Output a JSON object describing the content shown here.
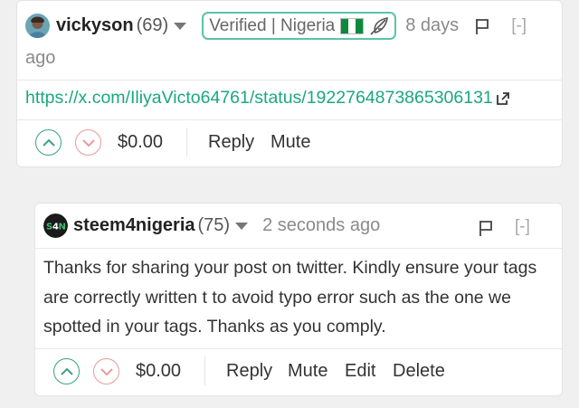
{
  "comment1": {
    "author": "vickyson",
    "reputation": "(69)",
    "badge_text": "Verified | Nigeria",
    "time_part1": "8 days",
    "time_part2": "ago",
    "collapse": "[-]",
    "link": "https://x.com/IliyaVicto64761/status/1922764873865306131",
    "payout": "$0.00",
    "actions": [
      "Reply",
      "Mute"
    ]
  },
  "comment2": {
    "author": "steem4nigeria",
    "reputation": "(75)",
    "time": "2 seconds ago",
    "collapse": "[-]",
    "body": "Thanks for sharing your post on twitter. Kindly ensure your tags are correctly written t to avoid typo error such as the one we spotted in your tags. Thanks as you comply.",
    "payout": "$0.00",
    "actions": [
      "Reply",
      "Mute",
      "Edit",
      "Delete"
    ]
  },
  "colors": {
    "accent": "#1ba87e",
    "upvote": "#3ba47d",
    "downvote": "#e99b9b",
    "badge_border": "#5bc3a7"
  },
  "icons": [
    "user-avatar",
    "nigeria-flag",
    "feather-icon",
    "flag-icon",
    "external-link-icon",
    "upvote-icon",
    "downvote-icon",
    "steem4nigeria-logo"
  ]
}
